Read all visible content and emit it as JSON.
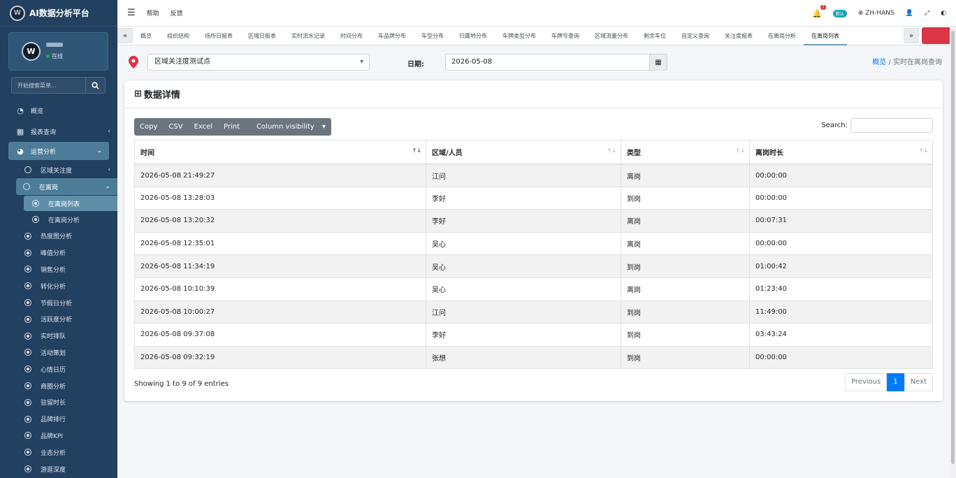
{
  "brand": {
    "title": "AI数据分析平台"
  },
  "user": {
    "status": "在线"
  },
  "sidebar": {
    "search_placeholder": "开始搜索菜单...",
    "items": [
      {
        "label": "概览",
        "icon": "dashboard-icon"
      },
      {
        "label": "报表查询",
        "icon": "grid-icon"
      },
      {
        "label": "运营分析",
        "icon": "pie-chart-icon"
      }
    ],
    "sub_items": [
      {
        "label": "区域关注度"
      },
      {
        "label": "在离岗"
      }
    ],
    "sub2_items": [
      {
        "label": "在离岗列表"
      },
      {
        "label": "在离岗分析"
      }
    ],
    "more_items": [
      {
        "label": "热度图分析"
      },
      {
        "label": "峰值分析"
      },
      {
        "label": "销售分析"
      },
      {
        "label": "转化分析"
      },
      {
        "label": "节假日分析"
      },
      {
        "label": "活跃度分析"
      },
      {
        "label": "实时排队"
      },
      {
        "label": "活动策划"
      },
      {
        "label": "心情日历"
      },
      {
        "label": "商圈分析"
      },
      {
        "label": "驻留时长"
      },
      {
        "label": "品牌排行"
      },
      {
        "label": "品牌KPI"
      },
      {
        "label": "业态分析"
      },
      {
        "label": "游逛深度"
      }
    ]
  },
  "topbar": {
    "help": "帮助",
    "feedback": "反馈",
    "bell_count": "7",
    "default_pill": "默认",
    "language": "ZH-HANS"
  },
  "tabs": [
    "概览",
    "组织结构",
    "场所日报表",
    "区域日报表",
    "实时流水记录",
    "时间分布",
    "车品牌分布",
    "车型分布",
    "归属地分布",
    "车牌类型分布",
    "车牌号查询",
    "区域流量分布",
    "剩余车位",
    "自定义查询",
    "关注度报表",
    "在离岗分析",
    "在离岗列表"
  ],
  "filter": {
    "area_value": "区域关注度测试点",
    "date_label": "日期:",
    "date_value": "2026-05-08"
  },
  "breadcrumb": {
    "home": "概览",
    "current": "实时在离岗查询"
  },
  "card": {
    "title": "数据详情"
  },
  "buttons": {
    "copy": "Copy",
    "csv": "CSV",
    "excel": "Excel",
    "print": "Print",
    "colvis": "Column visibility"
  },
  "search_label": "Search:",
  "table": {
    "headers": [
      "时间",
      "区域/人员",
      "类型",
      "离岗时长"
    ],
    "rows": [
      [
        "2026-05-08 21:49:27",
        "江问",
        "离岗",
        "00:00:00"
      ],
      [
        "2026-05-08 13:28:03",
        "李好",
        "到岗",
        "00:00:00"
      ],
      [
        "2026-05-08 13:20:32",
        "李好",
        "离岗",
        "00:07:31"
      ],
      [
        "2026-05-08 12:35:01",
        "吴心",
        "离岗",
        "00:00:00"
      ],
      [
        "2026-05-08 11:34:19",
        "吴心",
        "到岗",
        "01:00:42"
      ],
      [
        "2026-05-08 10:10:39",
        "吴心",
        "离岗",
        "01:23:40"
      ],
      [
        "2026-05-08 10:00:27",
        "江问",
        "到岗",
        "11:49:00"
      ],
      [
        "2026-05-08 09:37:08",
        "李好",
        "到岗",
        "03:43:24"
      ],
      [
        "2026-05-08 09:32:19",
        "张想",
        "到岗",
        "00:00:00"
      ]
    ]
  },
  "footer": {
    "showing": "Showing 1 to 9 of 9 entries",
    "previous": "Previous",
    "page": "1",
    "next": "Next"
  },
  "colors": {
    "sidebar": "#22405f",
    "accent": "#4c7c98",
    "primary": "#007bff",
    "danger": "#dc3545"
  }
}
